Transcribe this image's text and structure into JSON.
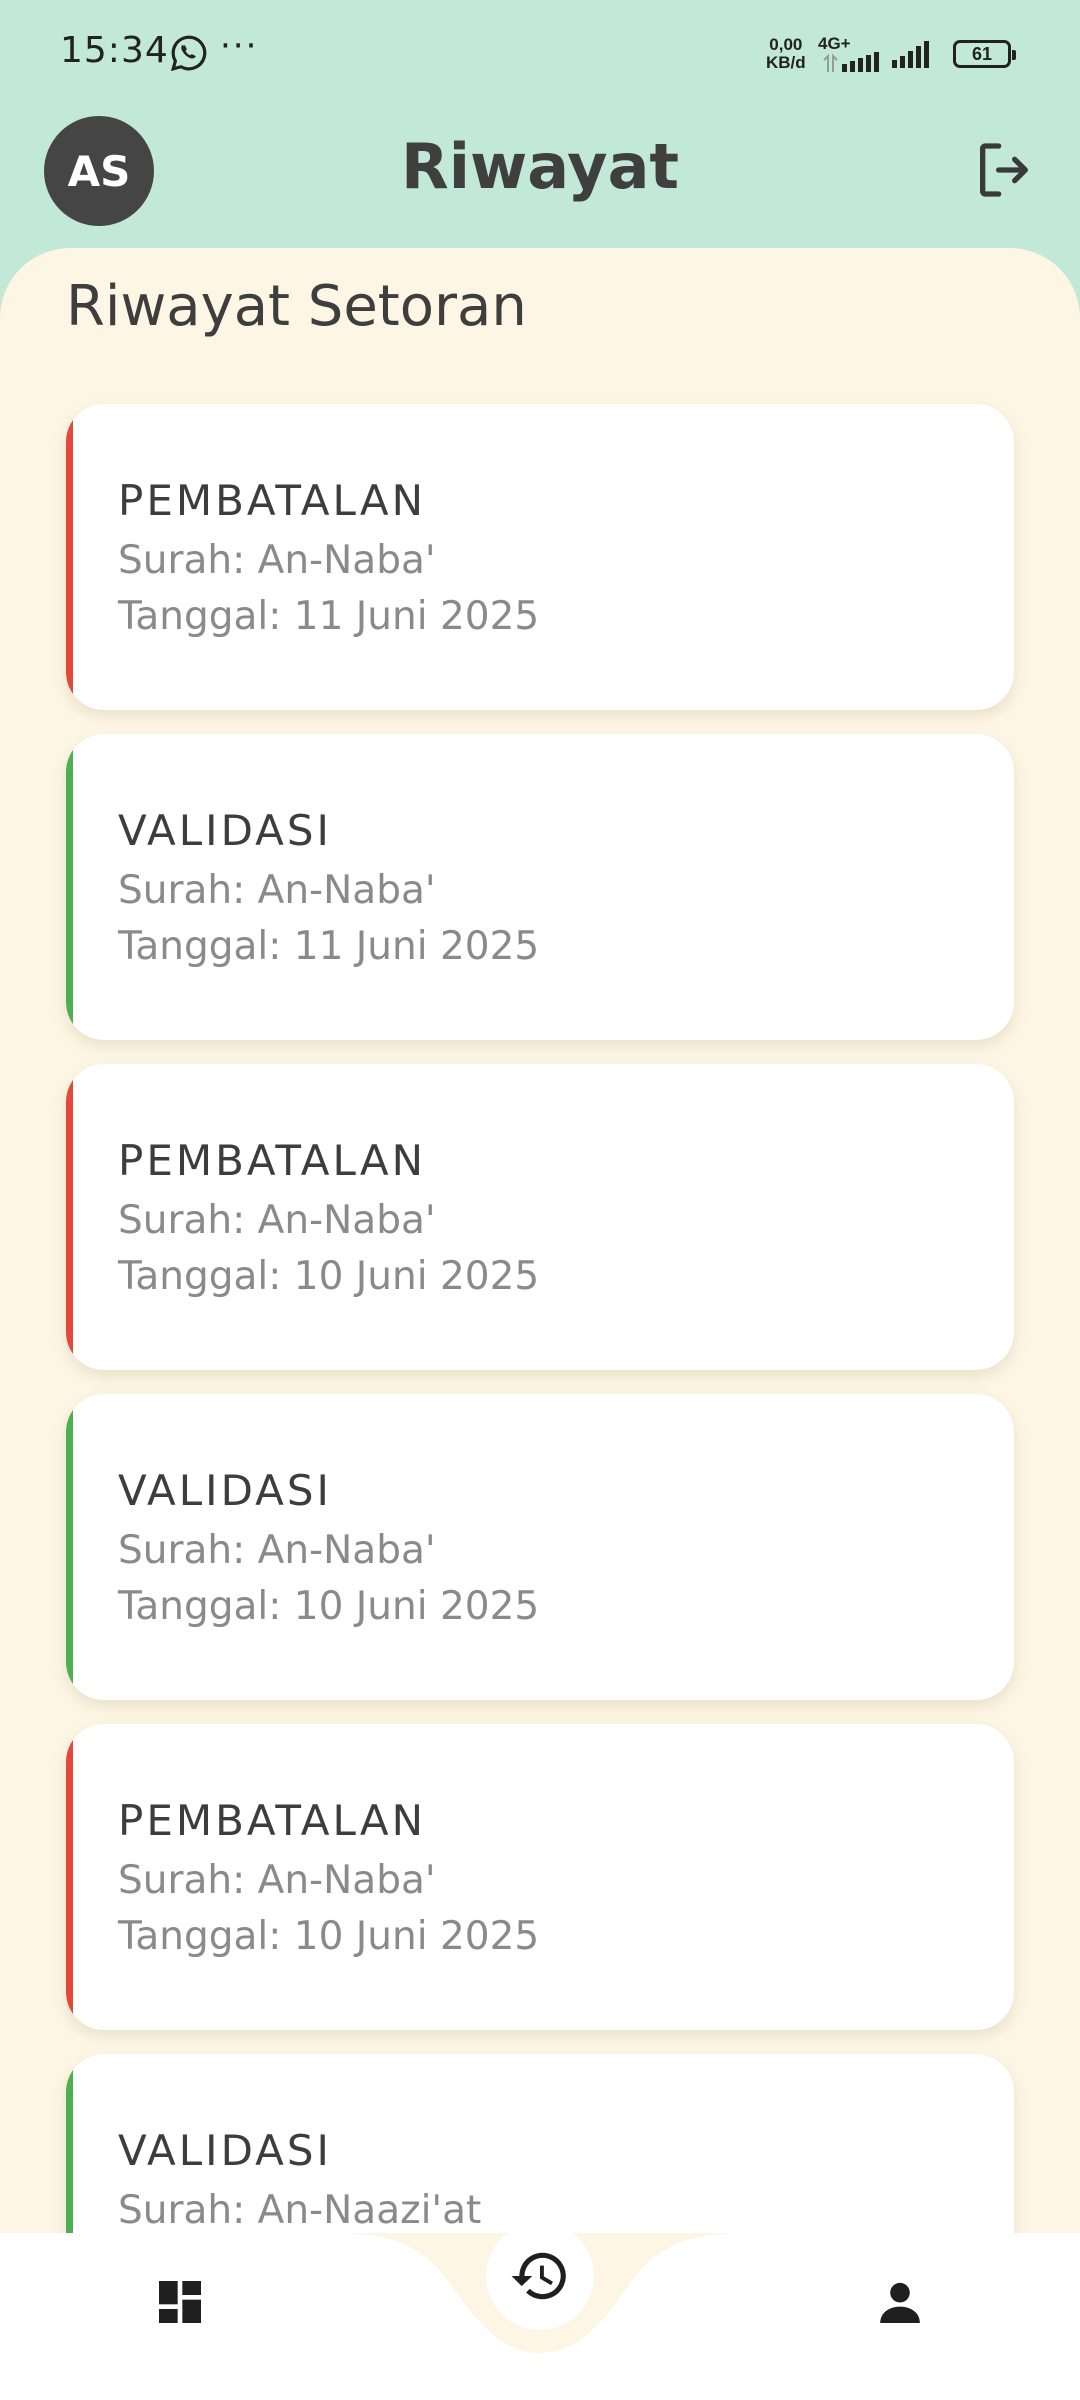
{
  "status_bar": {
    "time": "15:34",
    "more": "···",
    "net_speed_value": "0,00",
    "net_speed_unit": "KB/d",
    "net_type": "4G+",
    "battery": "61"
  },
  "header": {
    "avatar_initials": "AS",
    "title": "Riwayat"
  },
  "main": {
    "section_title": "Riwayat Setoran",
    "entries": [
      {
        "kind": "PEMBATALAN",
        "surah": "Surah: An-Naba'",
        "date": "Tanggal: 11 Juni 2025",
        "accent": "#e5473b"
      },
      {
        "kind": "VALIDASI",
        "surah": "Surah: An-Naba'",
        "date": "Tanggal: 11 Juni 2025",
        "accent": "#4caf50"
      },
      {
        "kind": "PEMBATALAN",
        "surah": "Surah: An-Naba'",
        "date": "Tanggal: 10 Juni 2025",
        "accent": "#e5473b"
      },
      {
        "kind": "VALIDASI",
        "surah": "Surah: An-Naba'",
        "date": "Tanggal: 10 Juni 2025",
        "accent": "#4caf50"
      },
      {
        "kind": "PEMBATALAN",
        "surah": "Surah: An-Naba'",
        "date": "Tanggal: 10 Juni 2025",
        "accent": "#e5473b"
      },
      {
        "kind": "VALIDASI",
        "surah": "Surah: An-Naazi'at",
        "date": "",
        "accent": "#4caf50"
      }
    ]
  },
  "bottom_nav": {
    "items": [
      {
        "icon": "dashboard-icon"
      },
      {
        "icon": "history-icon",
        "active": true
      },
      {
        "icon": "person-icon"
      }
    ]
  },
  "colors": {
    "header_bg": "#c2e8d7",
    "panel_bg": "#fdf6e4",
    "pembatalan_accent": "#e5473b",
    "validasi_accent": "#4caf50"
  }
}
